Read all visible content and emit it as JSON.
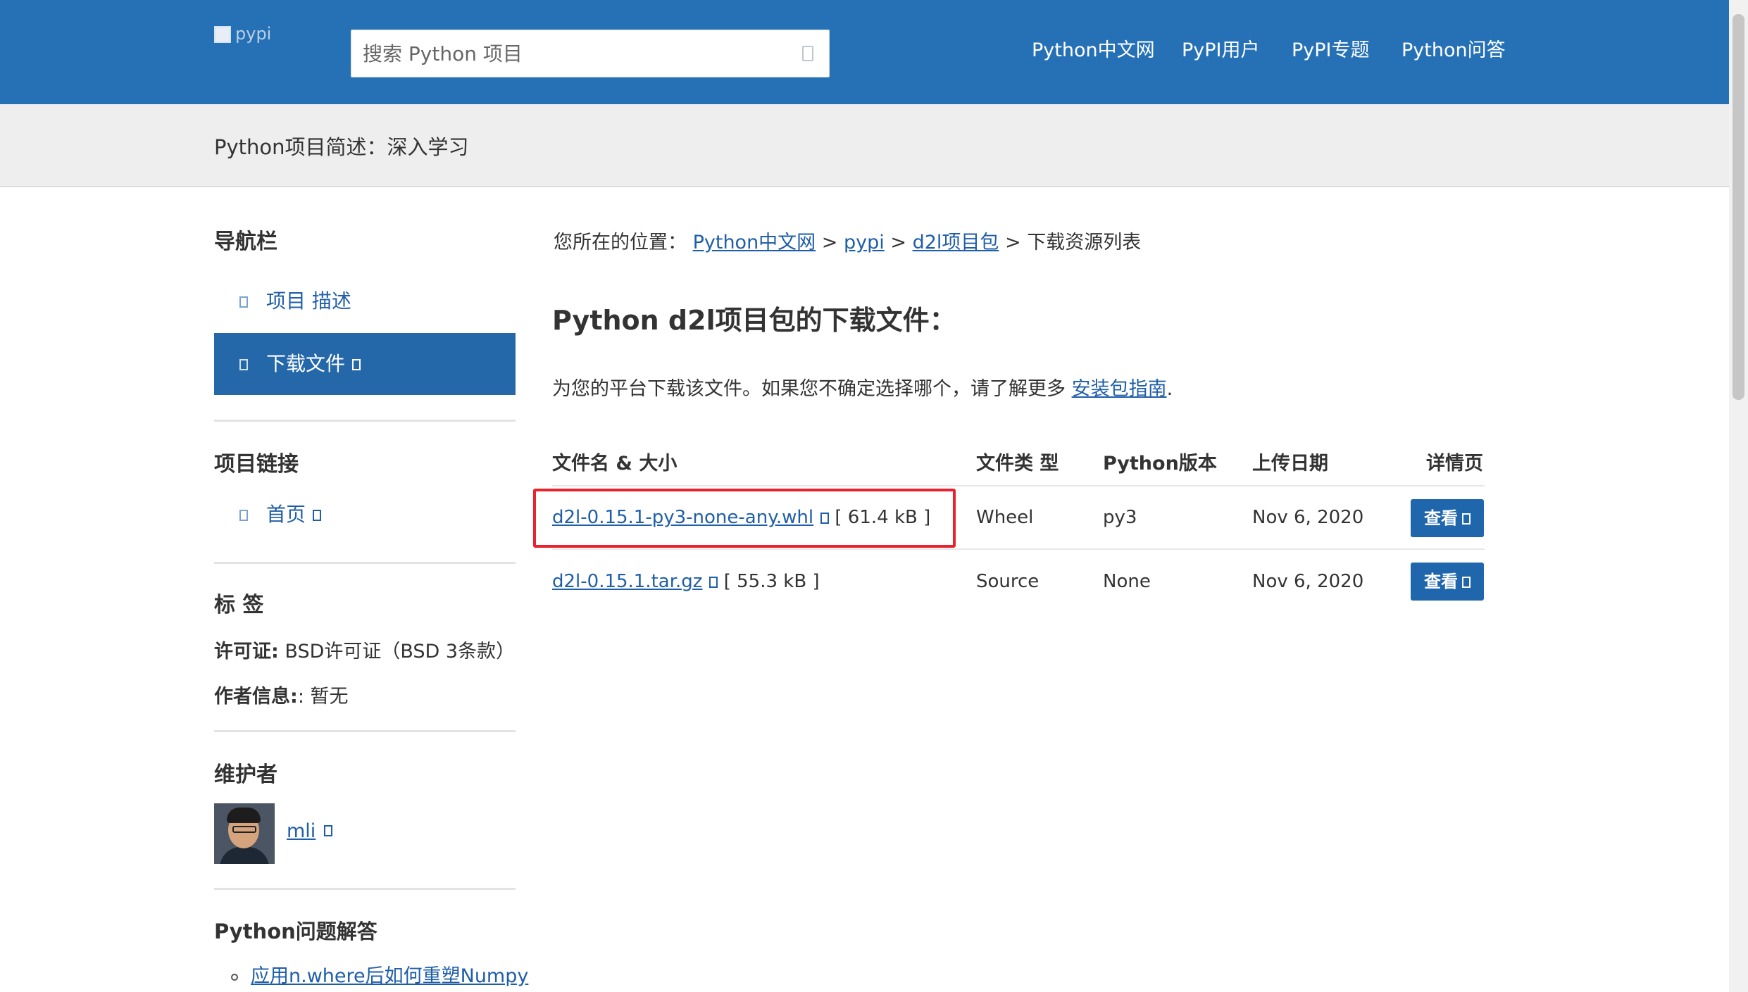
{
  "header": {
    "logo_alt": "pypi",
    "search_placeholder": "搜索 Python 项目",
    "nav": [
      "Python中文网",
      "PyPI用户",
      "PyPI专题",
      "Python问答"
    ]
  },
  "banner": {
    "title": "Python项目简述：深入学习"
  },
  "sidebar": {
    "nav_heading": "导航栏",
    "nav_items": [
      "项目 描述",
      "下载文件"
    ],
    "links_heading": "项目链接",
    "links": [
      "首页"
    ],
    "tags_heading": "标 签",
    "license_label": "许可证:",
    "license_value": " BSD许可证（BSD 3条款）",
    "author_label": "作者信息:",
    "author_value": ": 暂无",
    "maintainers_heading": "维护者",
    "maintainer": "mli",
    "qa_heading": "Python问题解答",
    "qa_items": [
      "应用n.where后如何重塑Numpy"
    ]
  },
  "main": {
    "breadcrumb_prefix": "您所在的位置：",
    "breadcrumb": [
      "Python中文网",
      "pypi",
      "d2l项目包",
      "下载资源列表"
    ],
    "breadcrumb_sep": ">",
    "title": "Python d2l项目包的下载文件：",
    "intro_text": "为您的平台下载该文件。如果您不确定选择哪个，请了解更多",
    "intro_link": "安装包指南",
    "intro_end": ".",
    "table": {
      "headers": [
        "文件名 & 大小",
        "文件类 型",
        "Python版本",
        "上传日期",
        "详情页"
      ],
      "rows": [
        {
          "file": "d2l-0.15.1-py3-none-any.whl",
          "size": "[ 61.4 kB ]",
          "type": "Wheel",
          "python": "py3",
          "date": "Nov 6, 2020",
          "action": "查看"
        },
        {
          "file": "d2l-0.15.1.tar.gz",
          "size": "[ 55.3 kB ]",
          "type": "Source",
          "python": "None",
          "date": "Nov 6, 2020",
          "action": "查看"
        }
      ]
    }
  },
  "colors": {
    "header_bg": "#2671b6",
    "active_nav_bg": "#2468aa",
    "link": "#1f5ea8",
    "button": "#1f66ad",
    "highlight": "#e8232e"
  }
}
